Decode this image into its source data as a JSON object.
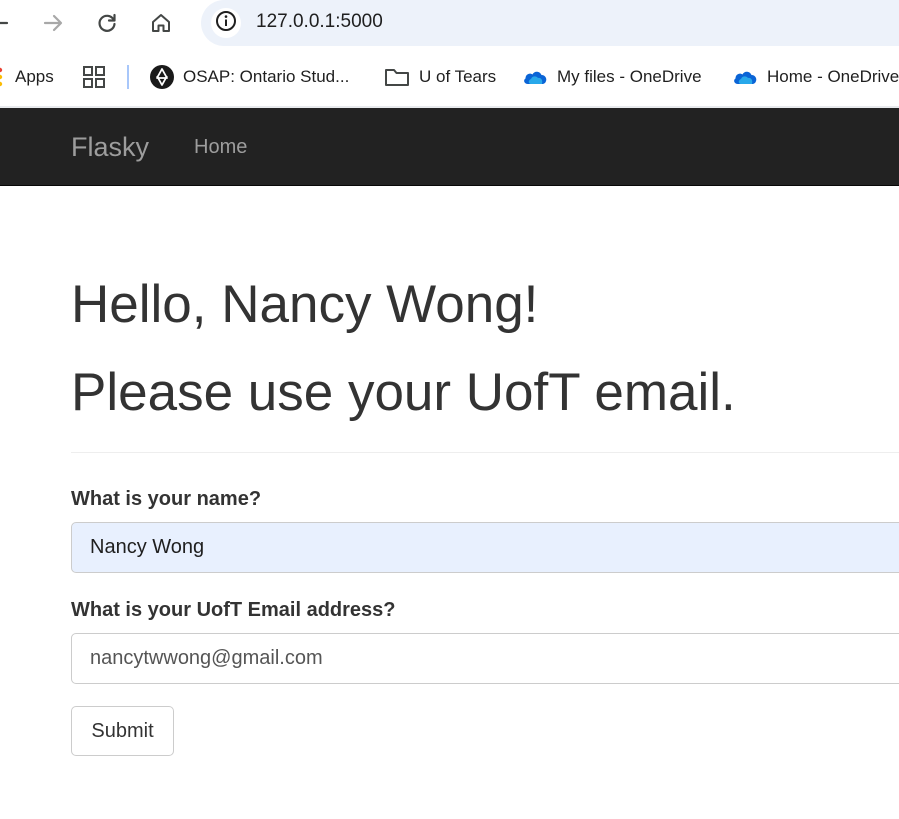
{
  "browser": {
    "url": "127.0.0.1:5000",
    "icons": {
      "back": "arrow-left-icon",
      "forward": "arrow-right-icon",
      "reload": "reload-icon",
      "home": "home-icon",
      "site_info": "info-icon"
    },
    "bookmarks": [
      {
        "label": "Apps",
        "icon": "apps-dots-icon"
      },
      {
        "label": "",
        "icon": "grid-icon"
      },
      {
        "label": "OSAP: Ontario Stud...",
        "icon": "ontario-trillium-icon"
      },
      {
        "label": "U of Tears",
        "icon": "folder-icon"
      },
      {
        "label": "My files - OneDrive",
        "icon": "onedrive-cloud-icon"
      },
      {
        "label": "Home - OneDrive",
        "icon": "onedrive-cloud-icon"
      }
    ],
    "accent_color": "#edf2fa"
  },
  "navbar": {
    "brand": "Flasky",
    "links": [
      {
        "label": "Home"
      }
    ],
    "background": "#222222",
    "link_color": "#9d9d9d"
  },
  "main": {
    "greeting": "Hello, Nancy Wong!",
    "warning": "Please use your UofT email.",
    "form": {
      "name_label": "What is your name?",
      "name_value": "Nancy Wong",
      "email_label": "What is your UofT Email address?",
      "email_value": "nancytwwong@gmail.com",
      "submit_label": "Submit"
    }
  }
}
